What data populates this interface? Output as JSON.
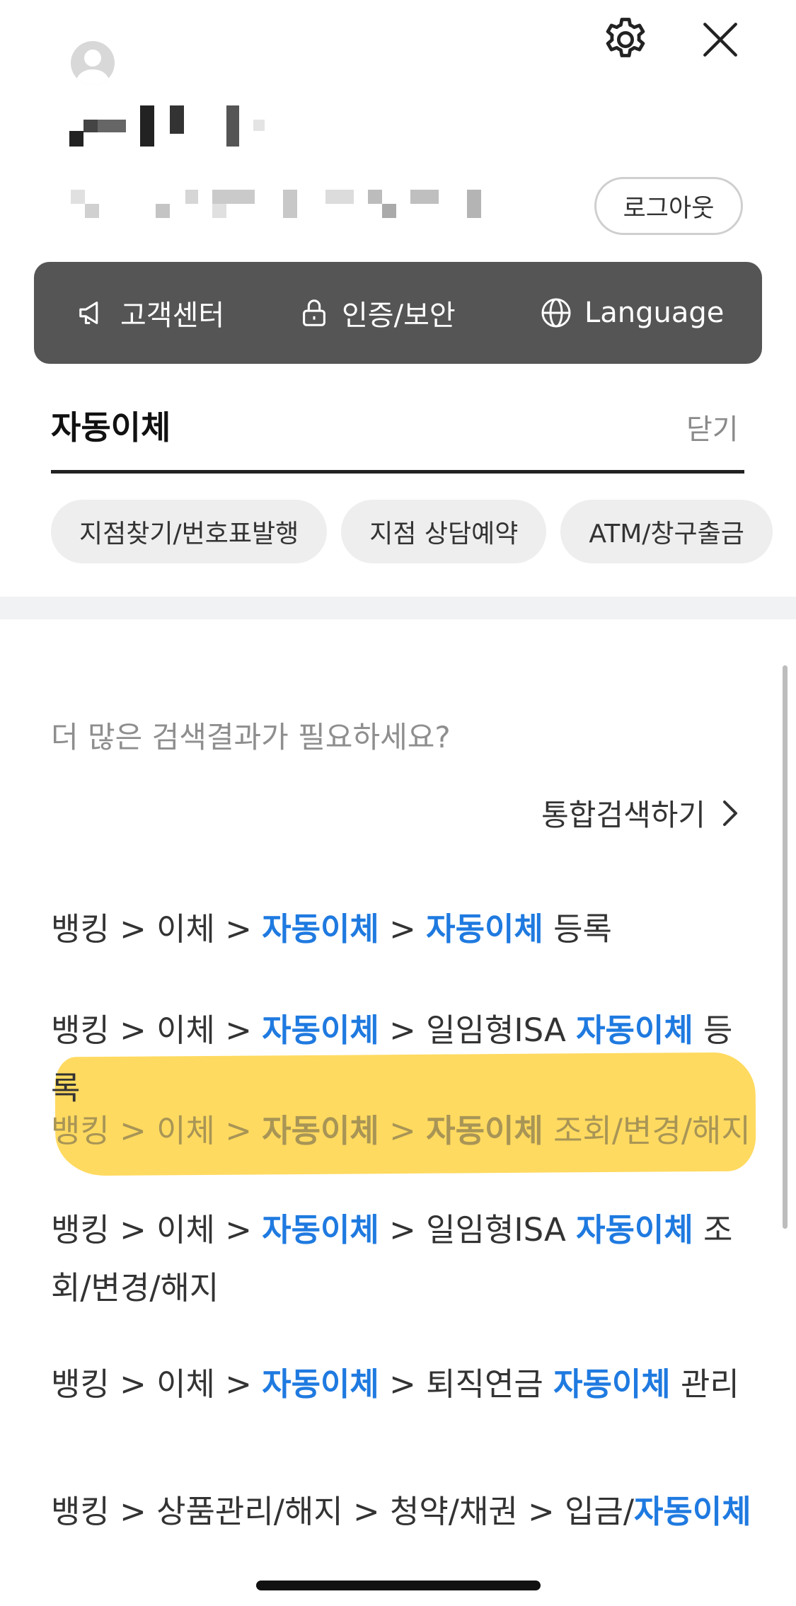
{
  "header": {
    "settings_icon": "gear-icon",
    "close_icon": "close-icon",
    "logout_label": "로그아웃"
  },
  "quickbar": {
    "items": [
      {
        "label": "고객센터",
        "icon": "megaphone-icon"
      },
      {
        "label": "인증/보안",
        "icon": "lock-icon"
      },
      {
        "label": "Language",
        "icon": "globe-icon"
      }
    ]
  },
  "tab": {
    "title": "자동이체",
    "close_label": "닫기"
  },
  "chips": [
    "지점찾기/번호표발행",
    "지점 상담예약",
    "ATM/창구출금"
  ],
  "more_search": {
    "question": "더 많은 검색결과가 필요하세요?",
    "link_label": "통합검색하기"
  },
  "results": [
    {
      "parts": [
        {
          "t": "뱅킹 > 이체 > ",
          "k": false
        },
        {
          "t": "자동이체",
          "k": true
        },
        {
          "t": " > ",
          "k": false
        },
        {
          "t": "자동이체",
          "k": true
        },
        {
          "t": " 등록",
          "k": false
        }
      ]
    },
    {
      "parts": [
        {
          "t": "뱅킹 > 이체 > ",
          "k": false
        },
        {
          "t": "자동이체",
          "k": true
        },
        {
          "t": " > 일임형ISA ",
          "k": false
        },
        {
          "t": "자동이체",
          "k": true
        },
        {
          "t": " 등록",
          "k": false
        }
      ]
    },
    {
      "parts": [
        {
          "t": "뱅킹 > 이체 > ",
          "k": false
        },
        {
          "t": "자동이체",
          "k": true
        },
        {
          "t": " > ",
          "k": false
        },
        {
          "t": "자동이체",
          "k": true
        },
        {
          "t": " 조회/변경/해지",
          "k": false
        }
      ]
    },
    {
      "parts": [
        {
          "t": "뱅킹 > 이체 > ",
          "k": false
        },
        {
          "t": "자동이체",
          "k": true
        },
        {
          "t": " > 일임형ISA ",
          "k": false
        },
        {
          "t": "자동이체",
          "k": true
        },
        {
          "t": " 조회/변경/해지",
          "k": false
        }
      ]
    },
    {
      "parts": [
        {
          "t": "뱅킹 > 이체 > ",
          "k": false
        },
        {
          "t": "자동이체",
          "k": true
        },
        {
          "t": " > 퇴직연금 ",
          "k": false
        },
        {
          "t": "자동이체",
          "k": true
        },
        {
          "t": " 관리",
          "k": false
        }
      ]
    },
    {
      "parts": [
        {
          "t": "뱅킹 > 상품관리/해지 > 청약/채권 > 입금/",
          "k": false
        },
        {
          "t": "자동이체",
          "k": true
        }
      ]
    }
  ],
  "colors": {
    "keyword": "#1f7ae0",
    "highlight": "#ffd54a",
    "quickbar": "#555555"
  }
}
